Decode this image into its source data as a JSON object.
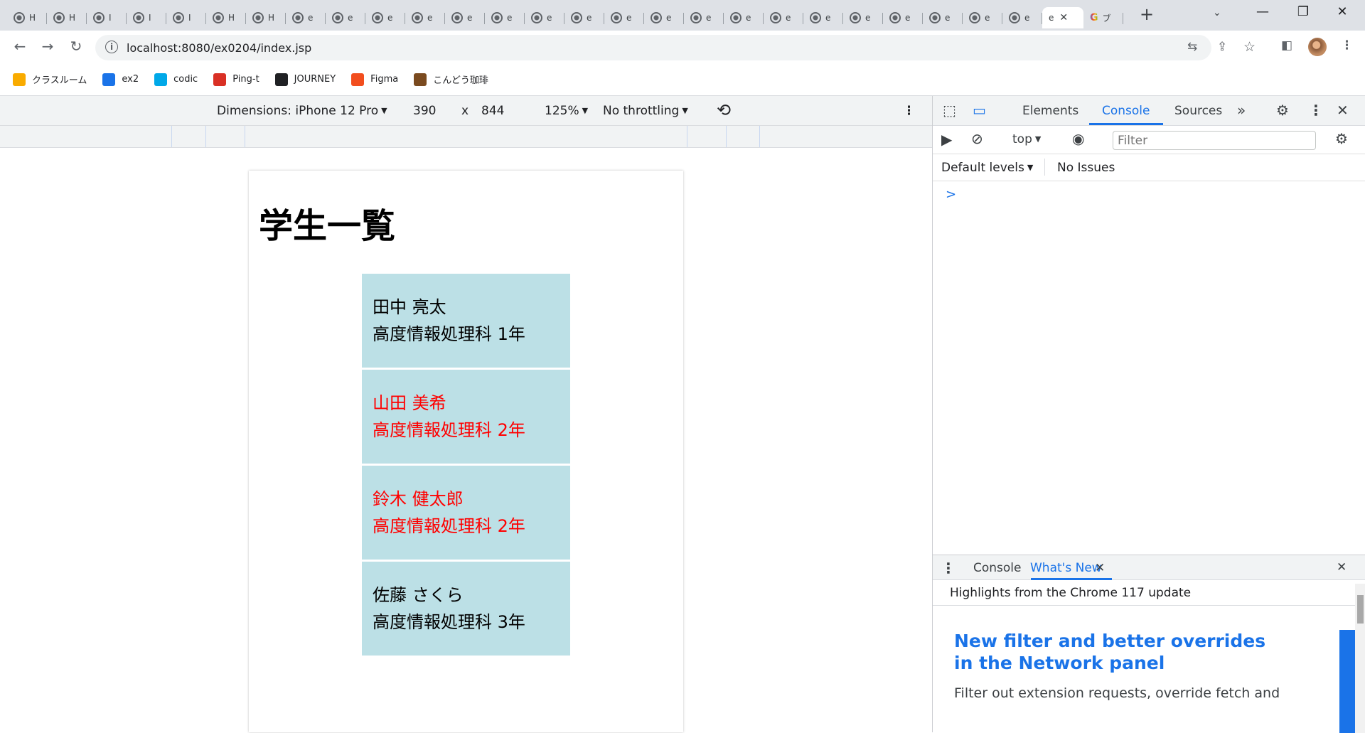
{
  "browser": {
    "tabs": [
      {
        "letter": "H"
      },
      {
        "letter": "H"
      },
      {
        "letter": "I"
      },
      {
        "letter": "I"
      },
      {
        "letter": "I"
      },
      {
        "letter": "H"
      },
      {
        "letter": "H"
      },
      {
        "letter": "e"
      },
      {
        "letter": "e"
      },
      {
        "letter": "e"
      },
      {
        "letter": "e"
      },
      {
        "letter": "e"
      },
      {
        "letter": "e"
      },
      {
        "letter": "e"
      },
      {
        "letter": "e"
      },
      {
        "letter": "e"
      },
      {
        "letter": "e"
      },
      {
        "letter": "e"
      },
      {
        "letter": "e"
      },
      {
        "letter": "e"
      },
      {
        "letter": "e"
      },
      {
        "letter": "e"
      },
      {
        "letter": "e"
      },
      {
        "letter": "e"
      },
      {
        "letter": "e"
      },
      {
        "letter": "e"
      }
    ],
    "active_tab": {
      "letter": "e",
      "close": "✕"
    },
    "google_tab": {
      "icon": "G",
      "letter": "ブ"
    },
    "new_tab": "+",
    "url": "localhost:8080/ex0204/index.jsp",
    "bookmarks": [
      {
        "label": "クラスルーム",
        "color": "#f9ab00"
      },
      {
        "label": "ex2",
        "color": "#1a73e8"
      },
      {
        "label": "codic",
        "color": "#00a8e8"
      },
      {
        "label": "Ping-t",
        "color": "#d93025"
      },
      {
        "label": "JOURNEY",
        "color": "#202124"
      },
      {
        "label": "Figma",
        "color": "#f24e1e"
      },
      {
        "label": "こんどう珈琲",
        "color": "#7a4a1f"
      }
    ]
  },
  "device_toolbar": {
    "dimensions": "Dimensions: iPhone 12 Pro",
    "width": "390",
    "times": "x",
    "height": "844",
    "zoom": "125%",
    "throttling": "No throttling"
  },
  "page": {
    "title": "学生一覧",
    "students": [
      {
        "name": "田中 亮太",
        "course": "高度情報処理科 1年",
        "color": "#000000"
      },
      {
        "name": "山田 美希",
        "course": "高度情報処理科 2年",
        "color": "#ff0000"
      },
      {
        "name": "鈴木 健太郎",
        "course": "高度情報処理科 2年",
        "color": "#ff0000"
      },
      {
        "name": "佐藤 さくら",
        "course": "高度情報処理科 3年",
        "color": "#000000"
      }
    ]
  },
  "devtools": {
    "tabs": [
      "Elements",
      "Console",
      "Sources"
    ],
    "active_tab": "Console",
    "context": "top",
    "filter_placeholder": "Filter",
    "levels": "Default levels",
    "issues": "No Issues",
    "prompt": ">",
    "drawer": {
      "tabs": [
        "Console",
        "What's New"
      ],
      "active_tab": "What's New",
      "highlights": "Highlights from the Chrome 117 update",
      "news_title": "New filter and better overrides in the Network panel",
      "news_body": "Filter out extension requests, override fetch and"
    },
    "accent_color": "#1a73e8"
  }
}
